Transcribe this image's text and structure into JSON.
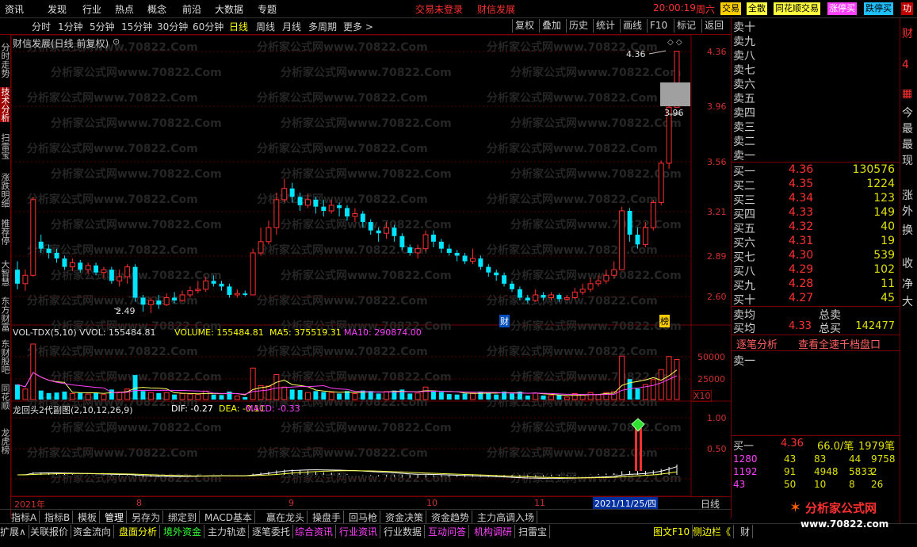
{
  "top_menu": {
    "items": [
      "资讯",
      "发现",
      "行业",
      "热点",
      "概念",
      "前沿",
      "大数据",
      "专题"
    ],
    "status_left": "交易未登录",
    "status_right": "财信发展",
    "time": "20:00:19",
    "weekday": "周六",
    "buttons": [
      "交易",
      "全散",
      "同花顺交易",
      "涨停买",
      "跌停买",
      "功"
    ]
  },
  "period_bar": {
    "tabs": [
      "分时",
      "1分钟",
      "5分钟",
      "15分钟",
      "30分钟",
      "60分钟",
      "日线",
      "周线",
      "月线",
      "多周期",
      "更多 >"
    ],
    "active": "日线",
    "right_tabs": [
      "复权",
      "叠加",
      "历史",
      "统计",
      "画线",
      "F10",
      "标记",
      "返回"
    ]
  },
  "left_tabs": [
    "分时走势",
    "技术分析",
    "扫雷宝",
    "涨跌明细",
    "推荐停",
    "大智慧",
    "东方财富",
    "东财股吧",
    "同花顺",
    "龙虎榜"
  ],
  "left_tab_active": "技术分析",
  "main_chart": {
    "title": "财信发展(日线 前复权)",
    "y_ticks": [
      "4.36",
      "3.96",
      "3.56",
      "3.21",
      "2.89",
      "2.60"
    ],
    "annotation_high": "4.36",
    "annotation_mid": "3.96",
    "annotation_low": "2.49",
    "markers": [
      "财",
      "榜"
    ]
  },
  "chart_data": {
    "type": "candlestick",
    "title": "财信发展(日线 前复权)",
    "y_range": [
      2.45,
      4.42
    ],
    "y_ticks": [
      4.36,
      3.96,
      3.56,
      3.21,
      2.89,
      2.6
    ],
    "candles": [
      [
        2.8,
        2.7,
        2.86,
        2.66
      ],
      [
        2.7,
        2.76,
        2.8,
        2.65
      ],
      [
        2.76,
        3.3,
        3.32,
        2.75
      ],
      [
        3.0,
        2.95,
        3.05,
        2.92
      ],
      [
        2.95,
        2.92,
        2.98,
        2.88
      ],
      [
        2.92,
        2.88,
        2.95,
        2.85
      ],
      [
        2.88,
        2.82,
        2.9,
        2.8
      ],
      [
        2.82,
        2.85,
        2.88,
        2.79
      ],
      [
        2.85,
        2.8,
        2.87,
        2.78
      ],
      [
        2.8,
        2.83,
        2.85,
        2.77
      ],
      [
        2.83,
        2.78,
        2.85,
        2.76
      ],
      [
        2.78,
        2.8,
        2.82,
        2.74
      ],
      [
        2.8,
        2.72,
        2.82,
        2.7
      ],
      [
        2.72,
        2.75,
        2.8,
        2.68
      ],
      [
        2.75,
        2.82,
        2.84,
        2.7
      ],
      [
        2.82,
        2.6,
        2.84,
        2.57
      ],
      [
        2.6,
        2.55,
        2.62,
        2.5
      ],
      [
        2.55,
        2.58,
        2.6,
        2.49
      ],
      [
        2.58,
        2.55,
        2.62,
        2.52
      ],
      [
        2.55,
        2.6,
        2.63,
        2.54
      ],
      [
        2.6,
        2.58,
        2.64,
        2.56
      ],
      [
        2.58,
        2.62,
        2.65,
        2.57
      ],
      [
        2.62,
        2.65,
        2.68,
        2.6
      ],
      [
        2.65,
        2.66,
        2.72,
        2.63
      ],
      [
        2.66,
        2.72,
        2.75,
        2.64
      ],
      [
        2.72,
        2.7,
        2.76,
        2.68
      ],
      [
        2.7,
        2.68,
        2.72,
        2.65
      ],
      [
        2.68,
        2.62,
        2.7,
        2.6
      ],
      [
        2.62,
        2.63,
        2.66,
        2.6
      ],
      [
        2.63,
        2.62,
        2.65,
        2.61
      ],
      [
        2.62,
        2.92,
        2.95,
        2.62
      ],
      [
        2.92,
        3.0,
        3.1,
        2.9
      ],
      [
        3.0,
        3.1,
        3.15,
        2.98
      ],
      [
        3.1,
        3.3,
        3.35,
        3.05
      ],
      [
        3.3,
        3.38,
        3.45,
        3.28
      ],
      [
        3.38,
        3.32,
        3.42,
        3.28
      ],
      [
        3.32,
        3.26,
        3.35,
        3.22
      ],
      [
        3.26,
        3.3,
        3.34,
        3.24
      ],
      [
        3.3,
        3.25,
        3.32,
        3.2
      ],
      [
        3.25,
        3.22,
        3.3,
        3.18
      ],
      [
        3.22,
        3.26,
        3.3,
        3.2
      ],
      [
        3.26,
        3.24,
        3.28,
        3.18
      ],
      [
        3.24,
        3.18,
        3.26,
        3.15
      ],
      [
        3.18,
        3.2,
        3.24,
        3.14
      ],
      [
        3.2,
        3.14,
        3.22,
        3.1
      ],
      [
        3.14,
        3.08,
        3.16,
        3.05
      ],
      [
        3.08,
        3.06,
        3.1,
        3.0
      ],
      [
        3.06,
        3.1,
        3.14,
        3.02
      ],
      [
        3.1,
        3.04,
        3.12,
        3.0
      ],
      [
        3.04,
        2.96,
        3.06,
        2.94
      ],
      [
        2.96,
        2.92,
        2.98,
        2.9
      ],
      [
        2.92,
        2.95,
        2.98,
        2.88
      ],
      [
        2.95,
        3.05,
        3.08,
        2.93
      ],
      [
        3.05,
        3.0,
        3.08,
        2.96
      ],
      [
        3.0,
        2.95,
        3.02,
        2.92
      ],
      [
        2.95,
        2.92,
        2.98,
        2.9
      ],
      [
        2.92,
        2.9,
        2.94,
        2.86
      ],
      [
        2.9,
        2.86,
        2.92,
        2.84
      ],
      [
        2.86,
        2.88,
        2.95,
        2.84
      ],
      [
        2.88,
        2.82,
        2.9,
        2.8
      ],
      [
        2.82,
        2.78,
        2.84,
        2.75
      ],
      [
        2.78,
        2.76,
        2.8,
        2.72
      ],
      [
        2.76,
        2.7,
        2.78,
        2.68
      ],
      [
        2.7,
        2.66,
        2.72,
        2.64
      ],
      [
        2.66,
        2.6,
        2.68,
        2.58
      ],
      [
        2.6,
        2.58,
        2.62,
        2.56
      ],
      [
        2.58,
        2.62,
        2.66,
        2.57
      ],
      [
        2.62,
        2.6,
        2.64,
        2.58
      ],
      [
        2.6,
        2.62,
        2.64,
        2.58
      ],
      [
        2.62,
        2.59,
        2.63,
        2.57
      ],
      [
        2.59,
        2.6,
        2.62,
        2.58
      ],
      [
        2.6,
        2.64,
        2.67,
        2.59
      ],
      [
        2.64,
        2.66,
        2.7,
        2.62
      ],
      [
        2.66,
        2.7,
        2.74,
        2.64
      ],
      [
        2.7,
        2.72,
        2.76,
        2.68
      ],
      [
        2.72,
        2.76,
        2.8,
        2.7
      ],
      [
        2.76,
        2.8,
        2.86,
        2.74
      ],
      [
        2.8,
        3.22,
        3.25,
        2.8
      ],
      [
        3.22,
        3.05,
        3.24,
        3.0
      ],
      [
        3.05,
        2.98,
        3.1,
        2.95
      ],
      [
        2.98,
        3.1,
        3.14,
        2.96
      ],
      [
        3.1,
        3.28,
        3.3,
        3.08
      ],
      [
        3.28,
        3.56,
        3.58,
        3.26
      ],
      [
        3.56,
        3.96,
        3.98,
        3.52
      ],
      [
        3.96,
        4.36,
        4.36,
        3.96
      ]
    ],
    "volume_legend": "VOL-TDX(5,10) VVOL: 155484.81",
    "volume_value": "VOLUME: 155484.81",
    "ma5": "MA5: 375519.31",
    "ma10": "MA10: 290874.00",
    "volume_ticks": [
      "50000",
      "25000"
    ],
    "volume_unit": "X10",
    "macd_legend": "龙回头2代副图(2,10,12,26,9)",
    "dif": "DIF: -0.27",
    "dea": "DEA: -0.11",
    "macd": "MACD: -0.33",
    "macd_ticks": [
      "1.00",
      "0.50"
    ],
    "time_labels": [
      "2021年",
      "8",
      "9",
      "10",
      "11",
      "2021/11/25/四"
    ]
  },
  "order_book": {
    "header_top": "卖十",
    "sell": [
      {
        "label": "卖十",
        "price": "",
        "vol": ""
      },
      {
        "label": "卖九",
        "price": "",
        "vol": ""
      },
      {
        "label": "卖八",
        "price": "",
        "vol": ""
      },
      {
        "label": "卖七",
        "price": "",
        "vol": ""
      },
      {
        "label": "卖六",
        "price": "",
        "vol": ""
      },
      {
        "label": "卖五",
        "price": "",
        "vol": ""
      },
      {
        "label": "卖四",
        "price": "",
        "vol": ""
      },
      {
        "label": "卖三",
        "price": "",
        "vol": ""
      },
      {
        "label": "卖二",
        "price": "",
        "vol": ""
      },
      {
        "label": "卖一",
        "price": "",
        "vol": ""
      }
    ],
    "buy": [
      {
        "label": "买一",
        "price": "4.36",
        "vol": "130576"
      },
      {
        "label": "买二",
        "price": "4.35",
        "vol": "1224"
      },
      {
        "label": "买三",
        "price": "4.34",
        "vol": "123"
      },
      {
        "label": "买四",
        "price": "4.33",
        "vol": "149"
      },
      {
        "label": "买五",
        "price": "4.32",
        "vol": "40"
      },
      {
        "label": "买六",
        "price": "4.31",
        "vol": "19"
      },
      {
        "label": "买七",
        "price": "4.30",
        "vol": "539"
      },
      {
        "label": "买八",
        "price": "4.29",
        "vol": "102"
      },
      {
        "label": "买九",
        "price": "4.28",
        "vol": "11"
      },
      {
        "label": "买十",
        "price": "4.27",
        "vol": "45"
      }
    ],
    "sell_avg_label": "卖均",
    "total_sell_label": "总卖",
    "buy_avg_label": "买均",
    "buy_avg": "4.33",
    "total_buy_label": "总买",
    "total_buy": "142477",
    "tab_left": "逐笔分析",
    "tab_right": "查看全速千档盘口",
    "queue_sell": "卖一",
    "queue_buy_label": "买一",
    "queue_buy_price": "4.36",
    "queue_buy_avg": "66.0/笔",
    "queue_buy_count": "1979笔",
    "queue_rows": [
      [
        "1280",
        "43",
        "83",
        "44",
        "9758"
      ],
      [
        "1192",
        "91",
        "4948",
        "5833",
        "2"
      ],
      [
        "43",
        "50",
        "10",
        "8",
        "26"
      ]
    ]
  },
  "right_edge": [
    "财",
    "4",
    "今",
    "最",
    "最",
    "现",
    "涨",
    "外",
    "换",
    "收",
    "净",
    "大"
  ],
  "timeaxis_right": "日线",
  "toolbar1": [
    "指标A",
    "指标B",
    "模板",
    "管理",
    "另存为",
    "绑定到",
    "MACD基本",
    "赢在龙头",
    "操盘手",
    "回马枪",
    "资金决策",
    "资金趋势",
    "主力高调入场"
  ],
  "toolbar2": [
    "扩展∧",
    "关联报价",
    "资金流向",
    "盘面分析",
    "境外资金",
    "主力轨迹",
    "逐笔委托",
    "综合资讯",
    "行业资讯",
    "行业数据",
    "互动问答",
    "机构调研",
    "扫雷宝",
    "图文F10",
    "侧边栏《",
    "财"
  ],
  "brand": {
    "name": "分析家公式网",
    "url": "www.70822.com"
  },
  "watermark": "分析家公式网www.70822.Com",
  "colors": {
    "up": "#ff3030",
    "down": "#00e5ff",
    "axis": "#c03030",
    "yellow": "#ffff00",
    "magenta": "#ff40ff"
  }
}
